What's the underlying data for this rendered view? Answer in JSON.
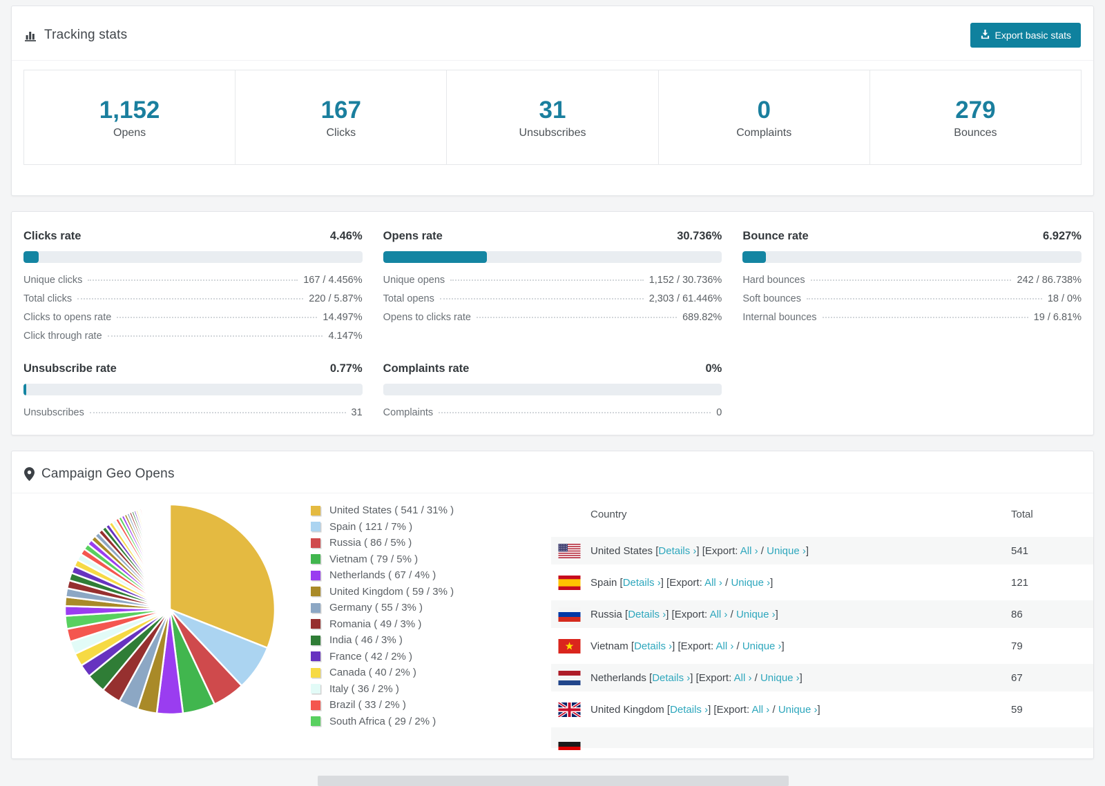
{
  "colors": {
    "accent": "#1a7f9e",
    "link": "#2ea7bd",
    "button_bg": "#0f819e",
    "progress_fill": "#1485a2",
    "progress_track": "#e9edf1",
    "row_alt_bg": "#f6f7f7"
  },
  "tracking": {
    "title": "Tracking stats",
    "icon": "bar-chart-icon",
    "export_button": {
      "label": "Export basic stats",
      "icon": "export-download-icon"
    },
    "stats": [
      {
        "value": "1,152",
        "label": "Opens"
      },
      {
        "value": "167",
        "label": "Clicks"
      },
      {
        "value": "31",
        "label": "Unsubscribes"
      },
      {
        "value": "0",
        "label": "Complaints"
      },
      {
        "value": "279",
        "label": "Bounces"
      }
    ]
  },
  "rates": [
    {
      "title": "Clicks rate",
      "percent": "4.46%",
      "fill_pct": 4.46,
      "rows": [
        {
          "label": "Unique clicks",
          "value": "167 / 4.456%"
        },
        {
          "label": "Total clicks",
          "value": "220 / 5.87%"
        },
        {
          "label": "Clicks to opens rate",
          "value": "14.497%"
        },
        {
          "label": "Click through rate",
          "value": "4.147%"
        }
      ]
    },
    {
      "title": "Opens rate",
      "percent": "30.736%",
      "fill_pct": 30.736,
      "rows": [
        {
          "label": "Unique opens",
          "value": "1,152 / 30.736%"
        },
        {
          "label": "Total opens",
          "value": "2,303 / 61.446%"
        },
        {
          "label": "Opens to clicks rate",
          "value": "689.82%"
        }
      ]
    },
    {
      "title": "Bounce rate",
      "percent": "6.927%",
      "fill_pct": 6.927,
      "rows": [
        {
          "label": "Hard bounces",
          "value": "242 / 86.738%"
        },
        {
          "label": "Soft bounces",
          "value": "18 / 0%"
        },
        {
          "label": "Internal bounces",
          "value": "19 / 6.81%"
        }
      ]
    },
    {
      "title": "Unsubscribe rate",
      "percent": "0.77%",
      "fill_pct": 0.77,
      "rows": [
        {
          "label": "Unsubscribes",
          "value": "31"
        }
      ]
    },
    {
      "title": "Complaints rate",
      "percent": "0%",
      "fill_pct": 0,
      "rows": [
        {
          "label": "Complaints",
          "value": "0"
        }
      ]
    }
  ],
  "geo": {
    "title": "Campaign Geo Opens",
    "icon": "map-pin-icon",
    "legend": [
      {
        "label": "United States ( 541 / 31% )",
        "color": "#e4ba41"
      },
      {
        "label": "Spain ( 121 / 7% )",
        "color": "#abd4f1"
      },
      {
        "label": "Russia ( 86 / 5% )",
        "color": "#cf4a4c"
      },
      {
        "label": "Vietnam ( 79 / 5% )",
        "color": "#41b64e"
      },
      {
        "label": "Netherlands ( 67 / 4% )",
        "color": "#9a3df0"
      },
      {
        "label": "United Kingdom ( 59 / 3% )",
        "color": "#a98a28"
      },
      {
        "label": "Germany ( 55 / 3% )",
        "color": "#8ca7c4"
      },
      {
        "label": "Romania ( 49 / 3% )",
        "color": "#96302f"
      },
      {
        "label": "India ( 46 / 3% )",
        "color": "#2f7d36"
      },
      {
        "label": "France ( 42 / 2% )",
        "color": "#6733c0"
      },
      {
        "label": "Canada ( 40 / 2% )",
        "color": "#f6da44"
      },
      {
        "label": "Italy ( 36 / 2% )",
        "color": "#e2fbf7"
      },
      {
        "label": "Brazil ( 33 / 2% )",
        "color": "#f4564f"
      },
      {
        "label": "South Africa ( 29 / 2% )",
        "color": "#58d05f"
      }
    ],
    "table": {
      "headers": {
        "country": "Country",
        "total": "Total"
      },
      "link_text": {
        "details": "Details ›",
        "export": "Export:",
        "all": "All ›",
        "unique": "Unique ›"
      },
      "rows": [
        {
          "flag": "us",
          "country": "United States",
          "total": "541"
        },
        {
          "flag": "es",
          "country": "Spain",
          "total": "121"
        },
        {
          "flag": "ru",
          "country": "Russia",
          "total": "86"
        },
        {
          "flag": "vn",
          "country": "Vietnam",
          "total": "79"
        },
        {
          "flag": "nl",
          "country": "Netherlands",
          "total": "67"
        },
        {
          "flag": "gb",
          "country": "United Kingdom",
          "total": "59"
        },
        {
          "flag": "de",
          "country": "",
          "total": "",
          "partial": true
        }
      ]
    }
  },
  "chart_data": {
    "type": "pie",
    "title": "Campaign Geo Opens",
    "labels": [
      "United States",
      "Spain",
      "Russia",
      "Vietnam",
      "Netherlands",
      "United Kingdom",
      "Germany",
      "Romania",
      "India",
      "France",
      "Canada",
      "Italy",
      "Brazil",
      "South Africa"
    ],
    "values": [
      541,
      121,
      86,
      79,
      67,
      59,
      55,
      49,
      46,
      42,
      40,
      36,
      33,
      29
    ],
    "percents": [
      31,
      7,
      5,
      5,
      4,
      3,
      3,
      3,
      3,
      2,
      2,
      2,
      2,
      2
    ],
    "colors": [
      "#e4ba41",
      "#abd4f1",
      "#cf4a4c",
      "#41b64e",
      "#9a3df0",
      "#a98a28",
      "#8ca7c4",
      "#96302f",
      "#2f7d36",
      "#6733c0",
      "#f6da44",
      "#e2fbf7",
      "#f4564f",
      "#58d05f"
    ],
    "tail_colors": [
      "#9a3df0",
      "#a98a28",
      "#8ca7c4",
      "#96302f",
      "#2f7d36",
      "#6733c0",
      "#f6da44",
      "#e2fbf7",
      "#f4564f",
      "#58d05f"
    ],
    "others_percents": [
      1.5,
      1.4,
      1.32,
      1.25,
      1.18,
      1.12,
      1.06,
      1.0,
      0.95,
      0.9,
      0.85,
      0.8,
      0.76,
      0.72,
      0.68,
      0.64,
      0.6,
      0.56,
      0.53,
      0.5,
      0.47,
      0.44,
      0.41,
      0.38,
      0.36,
      0.34,
      0.32,
      0.3,
      0.28,
      0.26,
      0.24,
      0.22,
      0.2,
      0.18,
      0.17,
      0.16,
      0.15,
      0.14,
      0.13,
      0.12,
      0.11,
      0.1
    ],
    "legend_position": "right",
    "start_angle_deg": -90,
    "direction": "clockwise"
  }
}
